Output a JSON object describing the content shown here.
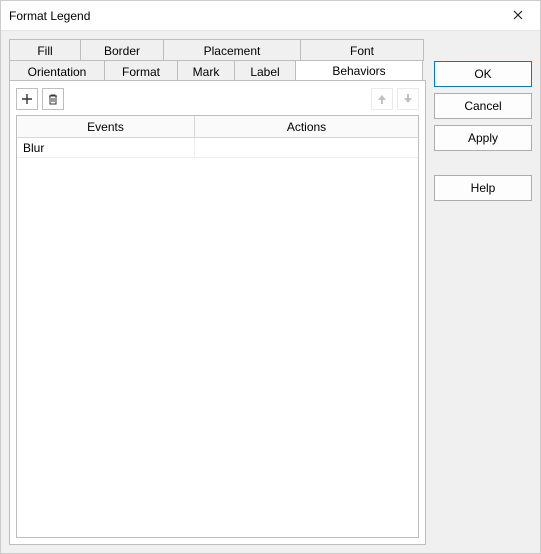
{
  "window": {
    "title": "Format Legend"
  },
  "tabs": {
    "row1": {
      "fill": "Fill",
      "border": "Border",
      "placement": "Placement",
      "font": "Font"
    },
    "row2": {
      "orientation": "Orientation",
      "format": "Format",
      "mark": "Mark",
      "label": "Label",
      "behaviors": "Behaviors"
    },
    "active": "Behaviors"
  },
  "behaviors_grid": {
    "columns": {
      "events": "Events",
      "actions": "Actions"
    },
    "rows": [
      {
        "event": "Blur",
        "action": ""
      }
    ]
  },
  "buttons": {
    "ok": "OK",
    "cancel": "Cancel",
    "apply": "Apply",
    "help": "Help"
  }
}
